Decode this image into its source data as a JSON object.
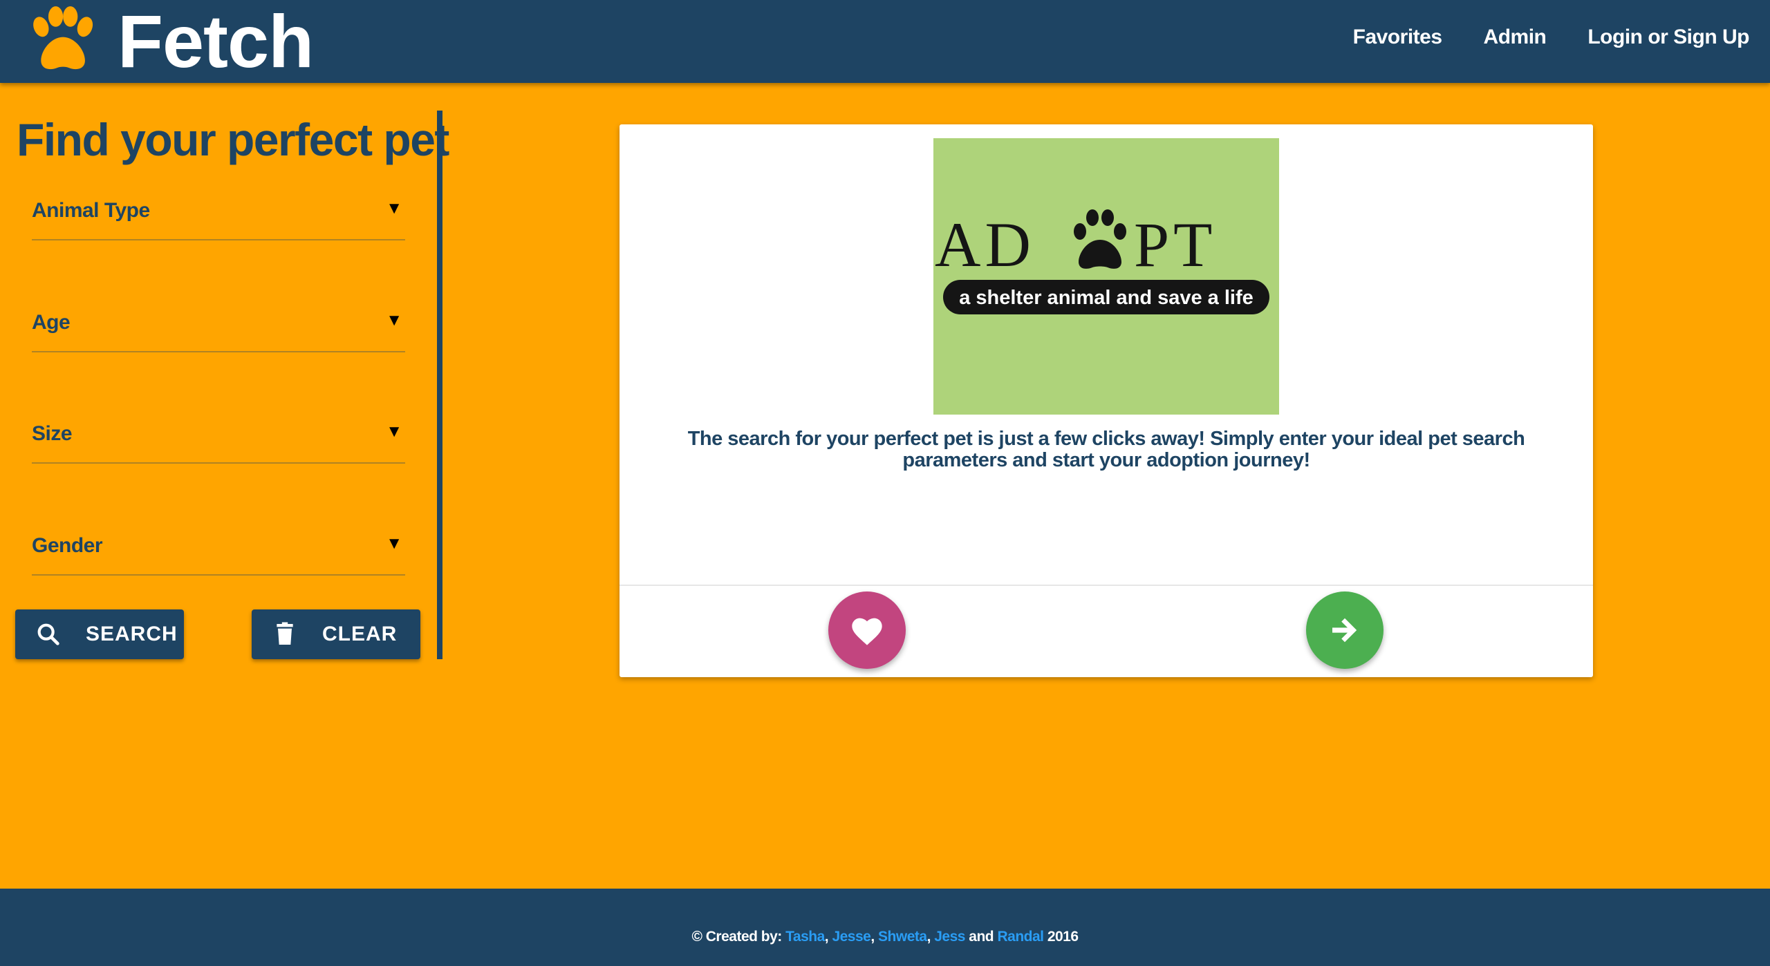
{
  "header": {
    "brand": "Fetch",
    "nav": [
      "Favorites",
      "Admin",
      "Login or Sign Up"
    ]
  },
  "sidebar": {
    "title": "Find your perfect pet",
    "filters": [
      {
        "label": "Animal Type"
      },
      {
        "label": "Age"
      },
      {
        "label": "Size"
      },
      {
        "label": "Gender"
      }
    ],
    "search_label": "SEARCH",
    "clear_label": "CLEAR"
  },
  "card": {
    "image": {
      "word_left": "AD",
      "word_right": "PT",
      "tagline": "a shelter animal and save a life"
    },
    "text": "The search for your perfect pet is just a few clicks away! Simply enter your ideal pet search parameters and start your adoption journey!"
  },
  "footer": {
    "prefix": "© Created by: ",
    "authors": [
      "Tasha",
      "Jesse",
      "Shweta",
      "Jess",
      "Randal"
    ],
    "sep1": ", ",
    "sep2": ", ",
    "sep3": ", ",
    "and": " and ",
    "year": " 2016"
  },
  "colors": {
    "background": "#FFA500",
    "navy": "#1E4463",
    "favorite_button": "#C2457F",
    "next_button": "#4CAF50",
    "footer_link": "#2A9DF4"
  }
}
